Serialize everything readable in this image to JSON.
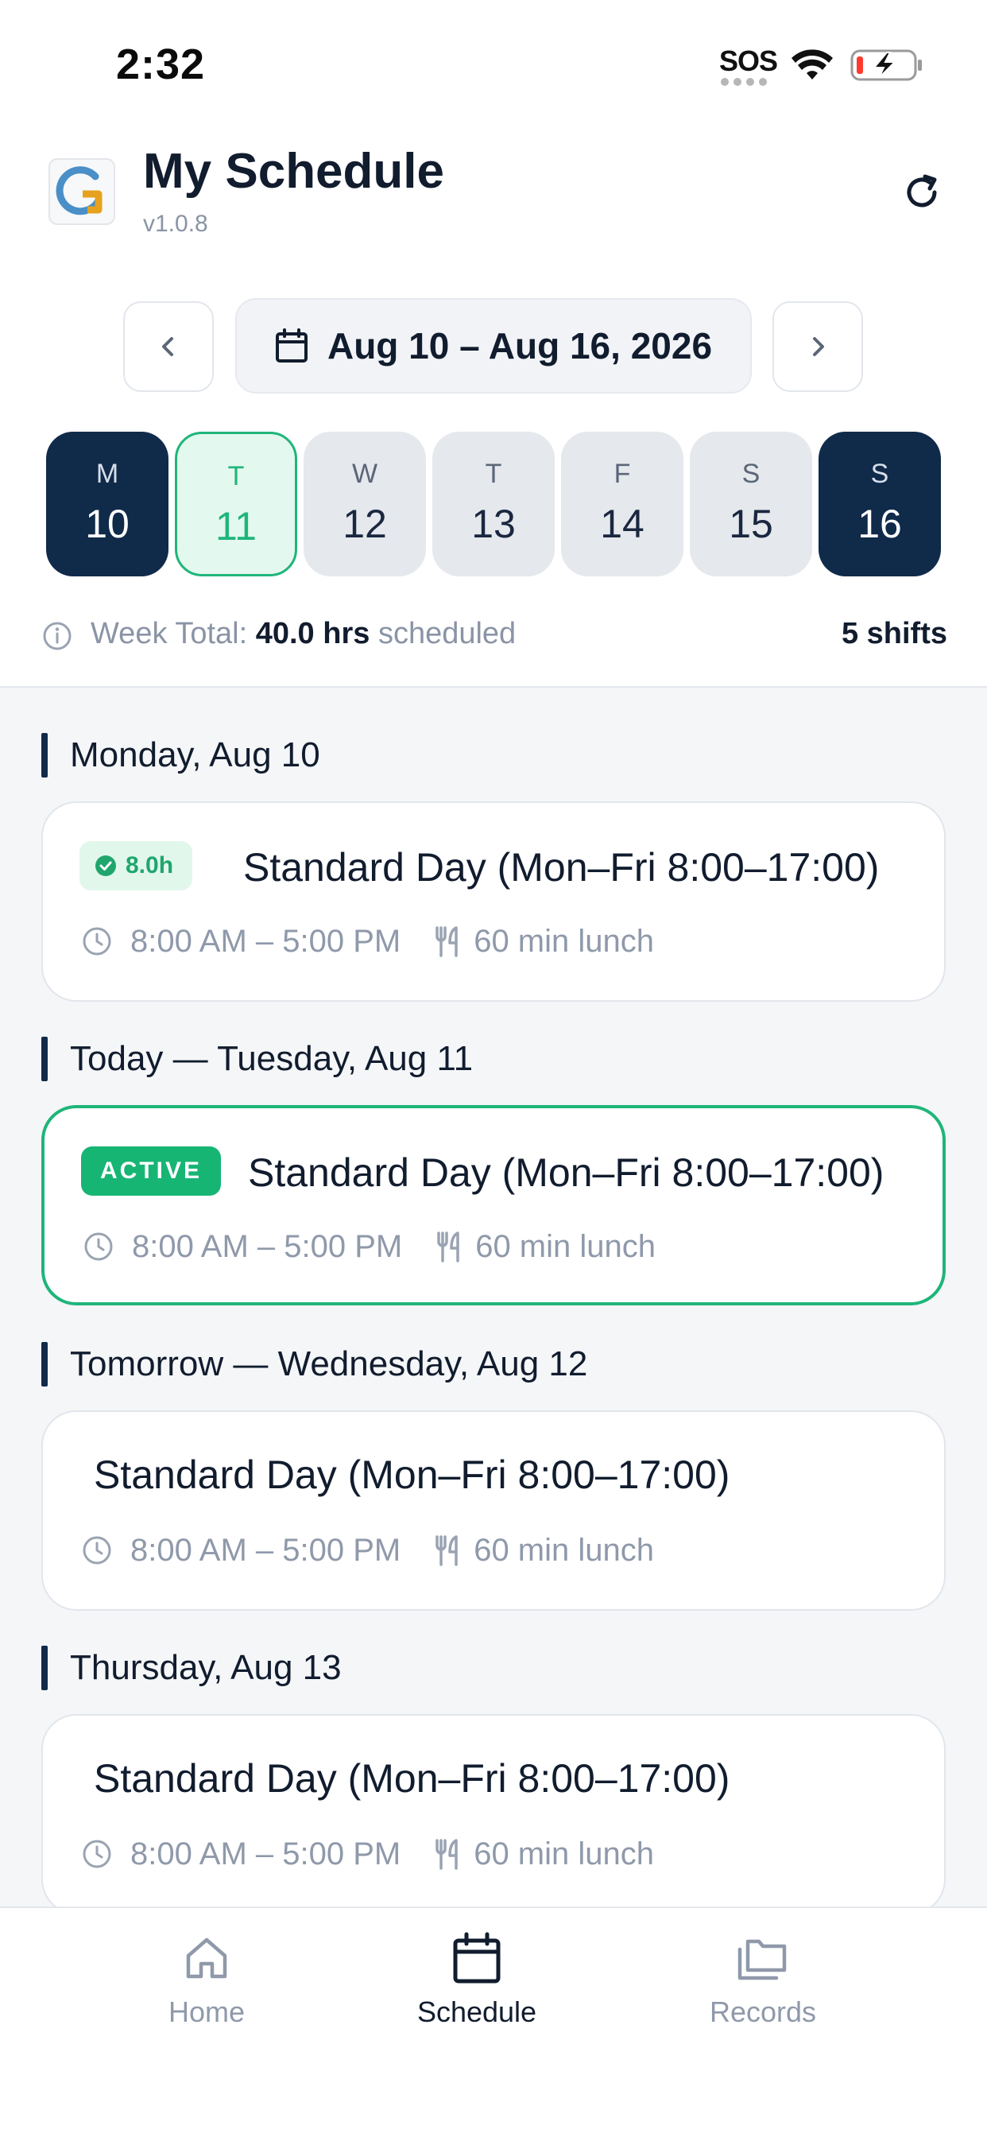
{
  "status_bar": {
    "time": "2:32",
    "sos": "SOS",
    "icons": [
      "wifi-icon",
      "battery-charging-icon"
    ]
  },
  "header": {
    "title": "My Schedule",
    "version": "v1.0.8",
    "logo": "g-logo-icon",
    "refresh_icon": "refresh-icon"
  },
  "week_nav": {
    "range": "Aug 10 – Aug 16, 2026",
    "prev_icon": "chevron-left-icon",
    "next_icon": "chevron-right-icon",
    "calendar_icon": "calendar-icon"
  },
  "days": [
    {
      "letter": "M",
      "num": "10",
      "state": "dark"
    },
    {
      "letter": "T",
      "num": "11",
      "state": "today"
    },
    {
      "letter": "W",
      "num": "12",
      "state": "normal"
    },
    {
      "letter": "T",
      "num": "13",
      "state": "normal"
    },
    {
      "letter": "F",
      "num": "14",
      "state": "normal"
    },
    {
      "letter": "S",
      "num": "15",
      "state": "normal"
    },
    {
      "letter": "S",
      "num": "16",
      "state": "dark"
    }
  ],
  "week_total": {
    "label": "Week Total:",
    "hours": "40.0 hrs",
    "suffix": "scheduled",
    "shifts": "5 shifts"
  },
  "sections": [
    {
      "title": "Monday, Aug 10",
      "shift": {
        "badge": "8.0h",
        "name": "Standard Day (Mon–Fri 8:00–17:00)",
        "time": "8:00 AM – 5:00 PM",
        "lunch": "60 min lunch"
      }
    },
    {
      "title": "Today — Tuesday, Aug 11",
      "shift": {
        "badge": "ACTIVE",
        "name": "Standard Day (Mon–Fri 8:00–17:00)",
        "time": "8:00 AM – 5:00 PM",
        "lunch": "60 min lunch"
      }
    },
    {
      "title": "Tomorrow — Wednesday, Aug 12",
      "shift": {
        "name": "Standard Day (Mon–Fri 8:00–17:00)",
        "time": "8:00 AM – 5:00 PM",
        "lunch": "60 min lunch"
      }
    },
    {
      "title": "Thursday, Aug 13",
      "shift": {
        "name": "Standard Day (Mon–Fri 8:00–17:00)",
        "time": "8:00 AM – 5:00 PM",
        "lunch": "60 min lunch"
      }
    }
  ],
  "tabs": [
    {
      "label": "Home",
      "icon": "home-icon"
    },
    {
      "label": "Schedule",
      "icon": "calendar-icon",
      "selected": true
    },
    {
      "label": "Records",
      "icon": "folders-icon"
    }
  ],
  "colors": {
    "navy": "#102a4a",
    "accent_green": "#1fb57a",
    "muted": "#8f99aa",
    "list_bg": "#f4f6f8"
  }
}
